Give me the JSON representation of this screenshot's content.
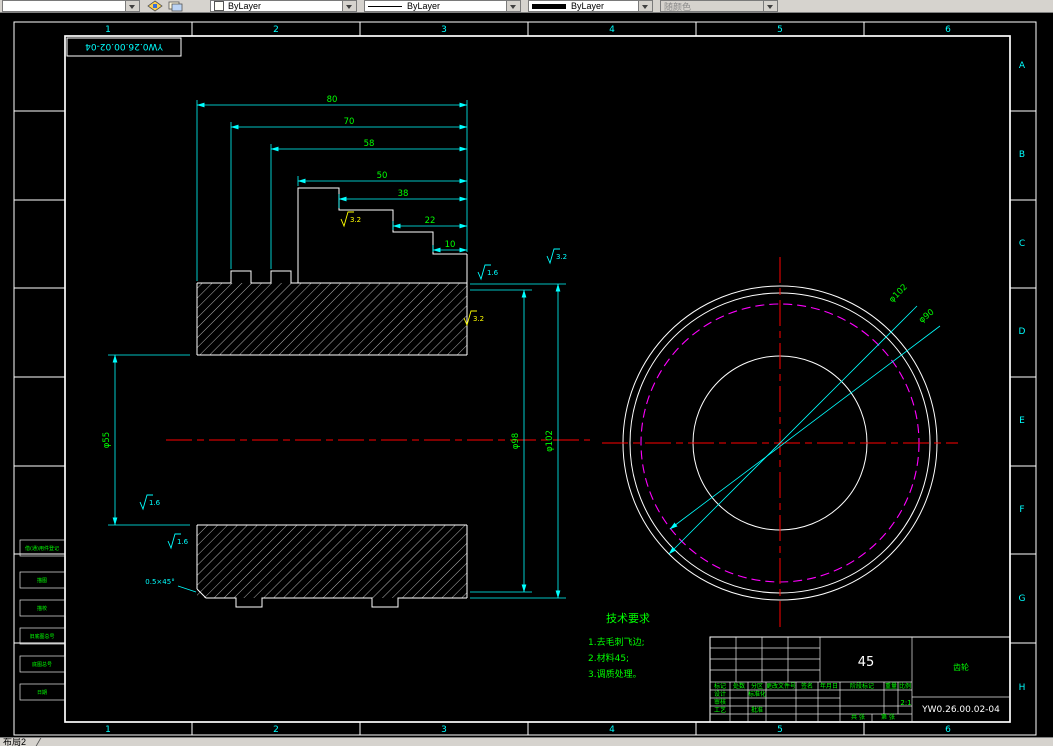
{
  "toolbar": {
    "layer_value": "",
    "color_value": "ByLayer",
    "linetype_value": "ByLayer",
    "lineweight_value": "ByLayer",
    "plotstyle_value": "随颜色"
  },
  "statusbar": {
    "layout_tab": "布局2"
  },
  "sheet": {
    "zones_top": [
      "1",
      "2",
      "3",
      "4",
      "5",
      "6"
    ],
    "zones_bottom": [
      "1",
      "2",
      "3",
      "4",
      "5",
      "6"
    ],
    "zones_right": [
      "A",
      "B",
      "C",
      "D",
      "E",
      "F",
      "G",
      "H"
    ],
    "corner_label": "YW0.26.00.02-04",
    "margin_blocks": [
      "借(通)用件登记",
      "描图",
      "描校",
      "旧底图总号",
      "底图总号",
      "日期"
    ]
  },
  "drawing": {
    "chain_dims": [
      "80",
      "70",
      "58",
      "50",
      "38",
      "22",
      "10"
    ],
    "dim_bore": "φ55",
    "dim_right_inner": "φ98",
    "dim_right_outer": "φ102",
    "circle_dim_outer": "φ102",
    "circle_dim_pitch": "φ90",
    "chamfer": "0.5×45°",
    "roughness": [
      "3.2",
      "1.6",
      "3.2",
      "3.2",
      "1.6",
      "1.6"
    ],
    "tech_title": "技术要求",
    "tech_items": [
      "1.去毛刺飞边;",
      "2.材料45;",
      "3.调质处理。"
    ]
  },
  "titleblock": {
    "material": "45",
    "part_name": "齿轮",
    "drawing_no": "YW0.26.00.02-04",
    "scale_value": "2:1",
    "labels": [
      "标记",
      "处数",
      "分区",
      "更改文件号",
      "签名",
      "年月日",
      "设计",
      "标准化",
      "审核",
      "工艺",
      "批准",
      "阶段标记",
      "重量",
      "比例",
      "共 张",
      "第 张"
    ]
  },
  "colors": {
    "dim_line": "#00ffff",
    "dim_text": "#00ff00",
    "centerline": "#ff0000",
    "pitch_circle": "#ff00ff",
    "outline": "#ffffff",
    "paper_bg": "#000000"
  }
}
